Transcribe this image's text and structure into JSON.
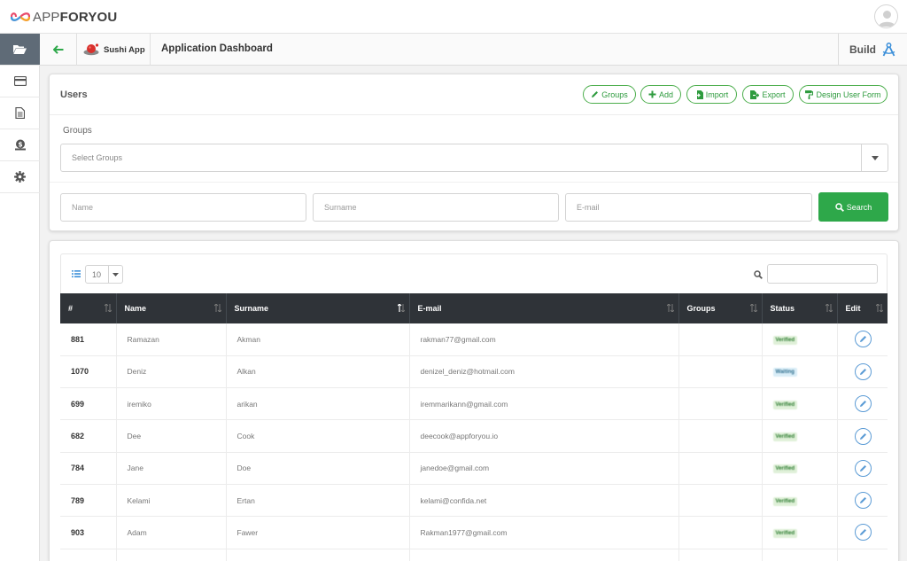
{
  "brand": {
    "logo_prefix": "APP",
    "logo_suffix": "FORYOU"
  },
  "sidebar": {
    "items": [
      {
        "icon": "folder-open-icon",
        "active": true
      },
      {
        "icon": "credit-card-icon"
      },
      {
        "icon": "document-icon"
      },
      {
        "icon": "money-icon"
      },
      {
        "icon": "gear-icon"
      }
    ]
  },
  "appbar": {
    "app_name": "Sushi App",
    "title": "Application Dashboard",
    "build_label": "Build"
  },
  "users": {
    "title": "Users",
    "buttons": {
      "groups": "Groups",
      "add": "Add",
      "import": "Import",
      "export": "Export",
      "design": "Design User Form"
    },
    "groups_label": "Groups",
    "groups_placeholder": "Select Groups",
    "name_placeholder": "Name",
    "surname_placeholder": "Surname",
    "email_placeholder": "E-mail",
    "search_label": "Search"
  },
  "table": {
    "page_length": "10",
    "columns": [
      "#",
      "Name",
      "Surname",
      "E-mail",
      "Groups",
      "Status",
      "Edit"
    ],
    "rows": [
      {
        "id": "881",
        "name": "Ramazan",
        "surname": "Akman",
        "email": "rakman77@gmail.com",
        "groups": "",
        "status": "Verified"
      },
      {
        "id": "1070",
        "name": "Deniz",
        "surname": "Alkan",
        "email": "denizel_deniz@hotmail.com",
        "groups": "",
        "status": "Waiting"
      },
      {
        "id": "699",
        "name": "iremiko",
        "surname": "arikan",
        "email": "iremmarikann@gmail.com",
        "groups": "",
        "status": "Verified"
      },
      {
        "id": "682",
        "name": "Dee",
        "surname": "Cook",
        "email": "deecook@appforyou.io",
        "groups": "",
        "status": "Verified"
      },
      {
        "id": "784",
        "name": "Jane",
        "surname": "Doe",
        "email": "janedoe@gmail.com",
        "groups": "",
        "status": "Verified"
      },
      {
        "id": "789",
        "name": "Kelami",
        "surname": "Ertan",
        "email": "kelami@confida.net",
        "groups": "",
        "status": "Verified"
      },
      {
        "id": "903",
        "name": "Adam",
        "surname": "Fawer",
        "email": "Rakman1977@gmail.com",
        "groups": "",
        "status": "Verified"
      }
    ]
  },
  "colors": {
    "accent_green": "#2ea84a",
    "header_dark": "#2f3338",
    "edit_blue": "#5b9bd5"
  }
}
